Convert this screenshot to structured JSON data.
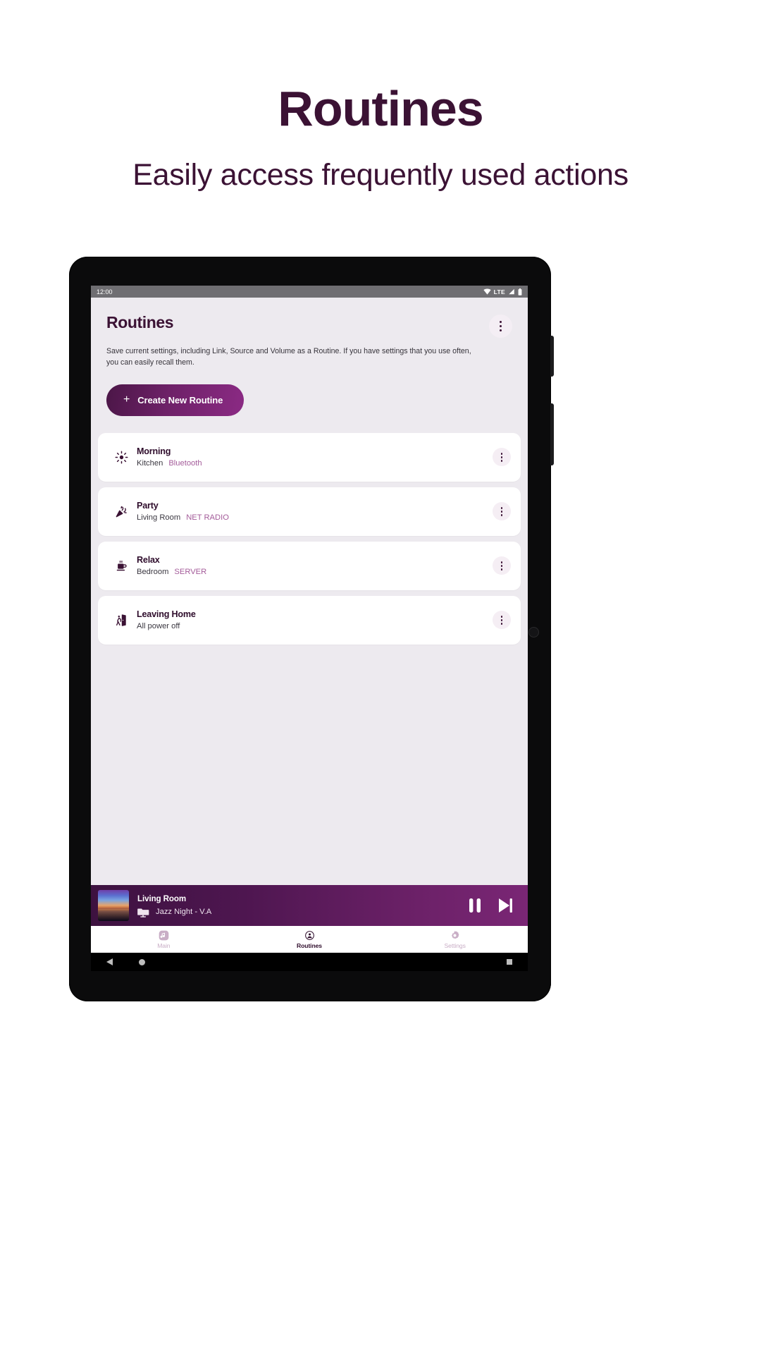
{
  "promo": {
    "title": "Routines",
    "subtitle": "Easily access frequently used actions"
  },
  "statusbar": {
    "time": "12:00",
    "network_label": "LTE",
    "icons": [
      "wifi-icon",
      "signal-icon",
      "battery-icon"
    ]
  },
  "app": {
    "title": "Routines",
    "overflow_icon": "kebab-menu-icon",
    "description": "Save current settings, including Link, Source and Volume as a Routine. If you have settings that you use often, you can easily recall them.",
    "create_button": {
      "label": "Create New Routine",
      "plus": "+"
    },
    "routines": [
      {
        "icon": "sun-icon",
        "name": "Morning",
        "room": "Kitchen",
        "source": "Bluetooth"
      },
      {
        "icon": "party-popper-icon",
        "name": "Party",
        "room": "Living Room",
        "source": "NET RADIO"
      },
      {
        "icon": "coffee-cup-icon",
        "name": "Relax",
        "room": "Bedroom",
        "source": "SERVER"
      },
      {
        "icon": "exit-door-icon",
        "name": "Leaving Home",
        "room": "All power off",
        "source": ""
      }
    ]
  },
  "player": {
    "room": "Living Room",
    "track": "Jazz Night - V.A",
    "source_icon": "folder-screen-icon",
    "pause_icon": "pause-icon",
    "next_icon": "next-track-icon"
  },
  "bottom_nav": [
    {
      "label": "Main",
      "icon": "music-note-icon",
      "active": false
    },
    {
      "label": "Routines",
      "icon": "routines-icon",
      "active": true
    },
    {
      "label": "Settings",
      "icon": "gear-icon",
      "active": false
    }
  ],
  "android_nav": {
    "back": "back-triangle-icon",
    "home": "home-circle-icon",
    "recents": "recents-square-icon"
  },
  "colors": {
    "brand_dark": "#3B1234",
    "accent": "#A45C9A",
    "screen_bg": "#EDEAEF",
    "card": "#FFFFFF"
  }
}
